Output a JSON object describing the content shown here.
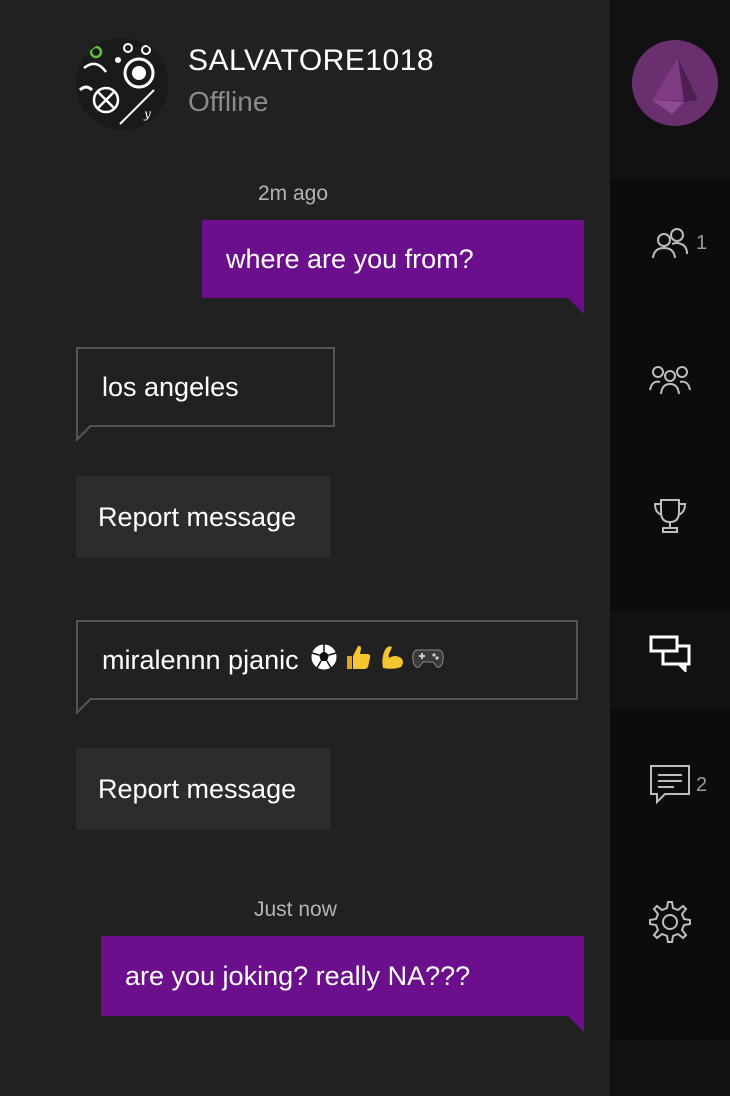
{
  "header": {
    "gamertag": "SALVATORE1018",
    "presence": "Offline",
    "avatar_icon": "controller-pattern-avatar"
  },
  "conversation": {
    "messages": [
      {
        "timestamp": "2m ago",
        "direction": "outgoing",
        "text": "where are you from?"
      },
      {
        "direction": "incoming",
        "text": "los angeles",
        "report_label": "Report message"
      },
      {
        "direction": "incoming",
        "text": "miralennn pjanic",
        "emojis": [
          "soccer-ball-icon",
          "thumbs-up-icon",
          "flexed-biceps-icon",
          "game-controller-icon"
        ],
        "report_label": "Report message"
      },
      {
        "timestamp": "Just now",
        "direction": "outgoing",
        "text": "are you joking? really NA???"
      }
    ]
  },
  "rail": {
    "items": [
      {
        "icon": "friends-icon",
        "count": "1"
      },
      {
        "icon": "party-icon",
        "count": ""
      },
      {
        "icon": "trophy-icon",
        "count": ""
      },
      {
        "icon": "chat-icon",
        "count": "",
        "active": true
      },
      {
        "icon": "notifications-icon",
        "count": "2"
      },
      {
        "icon": "settings-icon",
        "count": ""
      }
    ]
  },
  "colors": {
    "accent": "#6b0f8d",
    "panel": "#212121",
    "rail": "#111111",
    "report_button": "#2c2c2c",
    "incoming_border": "#555555"
  }
}
